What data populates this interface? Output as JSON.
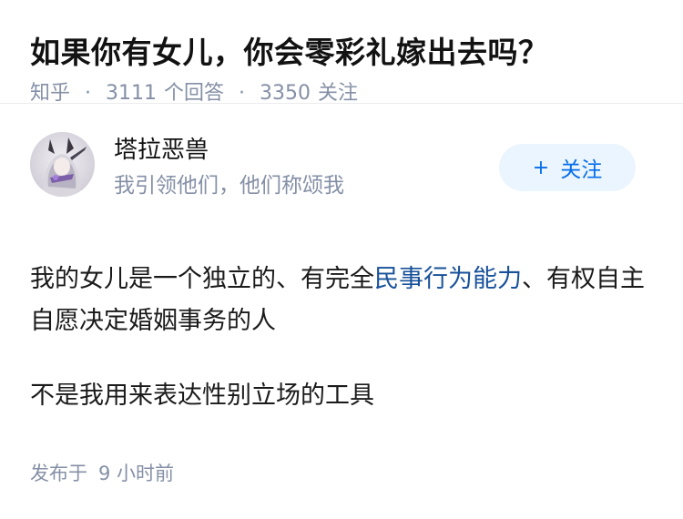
{
  "question": {
    "title": "如果你有女儿，你会零彩礼嫁出去吗？",
    "source": "知乎",
    "separator": "·",
    "answer_count": "3111",
    "answer_label": "个回答",
    "follower_count": "3350",
    "follower_label": "关注"
  },
  "author": {
    "name": "塔拉恶兽",
    "bio": "我引领他们，他们称颂我",
    "follow_icon": "+",
    "follow_label": "关注"
  },
  "answer": {
    "para1_before": "我的女儿是一个独立的、有完全",
    "para1_link": "民事行为能力",
    "para1_after": "、有权自主自愿决定婚姻事务的人",
    "para2": "不是我用来表达性别立场的工具",
    "published_label": "发布于",
    "published_time": "9 小时前"
  },
  "colors": {
    "link": "#175199",
    "follow_bg": "#ebf5ff",
    "follow_text": "#056de8",
    "meta_gray": "#8590a6"
  }
}
